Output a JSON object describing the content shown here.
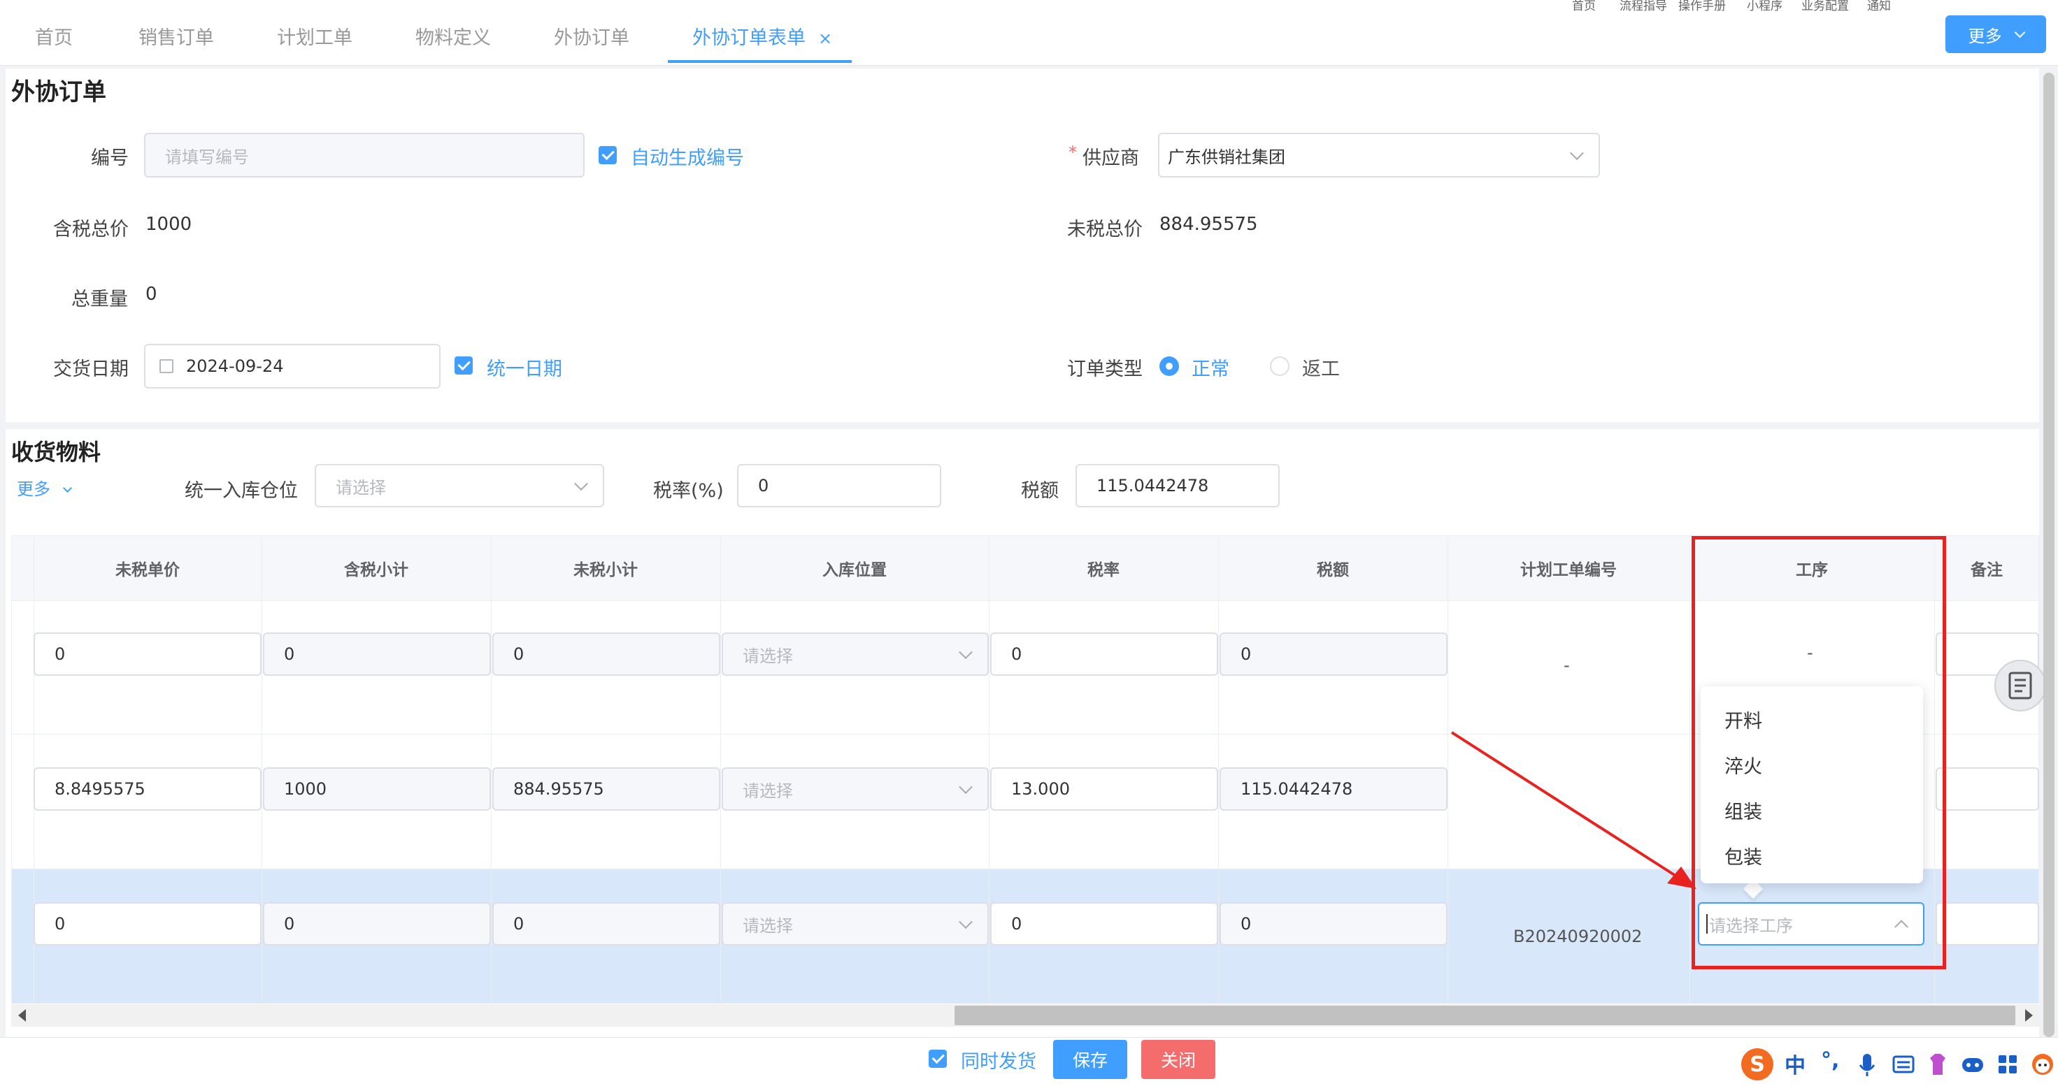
{
  "tabs": [
    {
      "label": "首页",
      "active": false
    },
    {
      "label": "销售订单",
      "active": false
    },
    {
      "label": "计划工单",
      "active": false
    },
    {
      "label": "物料定义",
      "active": false
    },
    {
      "label": "外协订单",
      "active": false
    },
    {
      "label": "外协订单表单",
      "active": true
    }
  ],
  "tab_close_glyph": "×",
  "top_links": [
    "首页",
    "流程指导",
    "操作手册",
    "小程序",
    "业务配置",
    "通知"
  ],
  "more_button": "更多",
  "header_section": {
    "title": "外协订单",
    "code_label": "编号",
    "code_placeholder": "请填写编号",
    "auto_code_label": "自动生成编号",
    "supplier_required": "*",
    "supplier_label": "供应商",
    "supplier_value": "广东供销社集团",
    "tax_total_label": "含税总价",
    "tax_total_value": "1000",
    "pretax_total_label": "未税总价",
    "pretax_total_value": "884.95575",
    "weight_label": "总重量",
    "weight_value": "0",
    "delivery_label": "交货日期",
    "delivery_value": "2024-09-24",
    "unify_date_label": "统一日期",
    "order_type_label": "订单类型",
    "order_type_options": [
      "正常",
      "返工"
    ],
    "order_type_selected": "正常"
  },
  "goods_section": {
    "title": "收货物料",
    "more_link": "更多",
    "warehouse_label": "统一入库仓位",
    "warehouse_placeholder": "请选择",
    "tax_rate_label": "税率(%)",
    "tax_rate_value": "0",
    "tax_amount_label": "税额",
    "tax_amount_value": "115.0442478"
  },
  "table": {
    "columns": [
      "未税单价",
      "含税小计",
      "未税小计",
      "入库位置",
      "税率",
      "税额",
      "计划工单编号",
      "工序",
      "备注"
    ],
    "rows": [
      {
        "unit_price": "0",
        "tax_subtotal": "0",
        "pretax_subtotal": "0",
        "location_placeholder": "请选择",
        "tax_rate": "0",
        "tax_amount": "0",
        "plan_no": "-",
        "process": "-"
      },
      {
        "unit_price": "8.8495575",
        "tax_subtotal": "1000",
        "pretax_subtotal": "884.95575",
        "location_placeholder": "请选择",
        "tax_rate": "13.000",
        "tax_amount": "115.0442478",
        "plan_no": "",
        "process": ""
      },
      {
        "unit_price": "0",
        "tax_subtotal": "0",
        "pretax_subtotal": "0",
        "location_placeholder": "请选择",
        "tax_rate": "0",
        "tax_amount": "0",
        "plan_no": "B20240920002",
        "process_placeholder": "请选择工序"
      }
    ]
  },
  "process_dropdown": {
    "options": [
      "开料",
      "淬火",
      "组装",
      "包装"
    ]
  },
  "bottom_bar": {
    "ship_together_label": "同时发货",
    "save_label": "保存",
    "close_label": "关闭"
  },
  "ime_toolbar": {
    "logo": "S",
    "mode": "中",
    "punct": "°,"
  },
  "colors": {
    "primary": "#409eff",
    "danger": "#f56c6c",
    "annotation": "#e8231f",
    "row_selected": "#d9e7fb"
  }
}
